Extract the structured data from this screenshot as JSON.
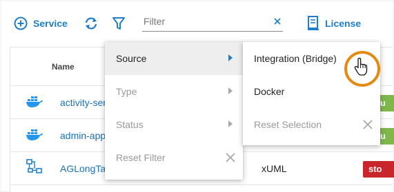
{
  "toolbar": {
    "service_label": "Service",
    "filter_placeholder": "Filter",
    "license_label": "License"
  },
  "table": {
    "header_name": "Name",
    "rows": [
      {
        "name": "activity-ser",
        "type": "",
        "status": "ru",
        "status_color": "#7fb84a"
      },
      {
        "name": "admin-app",
        "type": "",
        "status": "ru",
        "status_color": "#7fb84a"
      },
      {
        "name": "AGLongTa",
        "type": "xUML",
        "status": "sto",
        "status_color": "#c8262b"
      }
    ]
  },
  "filter_menu": {
    "items": [
      {
        "label": "Source",
        "enabled": true,
        "submenu": true,
        "highlight": true
      },
      {
        "label": "Type",
        "enabled": false,
        "submenu": true
      },
      {
        "label": "Status",
        "enabled": false,
        "submenu": true
      },
      {
        "label": "Reset Filter",
        "enabled": false,
        "clear": true
      }
    ]
  },
  "source_menu": {
    "items": [
      {
        "label": "Integration (Bridge)",
        "enabled": true
      },
      {
        "label": "Docker",
        "enabled": true
      },
      {
        "label": "Reset Selection",
        "enabled": false,
        "clear": true
      }
    ]
  },
  "colors": {
    "accent": "#1f7ec7",
    "link": "#1a73b6",
    "cursor_highlight": "#e58a10"
  },
  "icons": [
    "add-circle-icon",
    "refresh-icon",
    "funnel-icon",
    "clear-icon",
    "license-icon",
    "docker-icon",
    "integration-icon",
    "chevron-right-icon",
    "hand-cursor-icon"
  ]
}
